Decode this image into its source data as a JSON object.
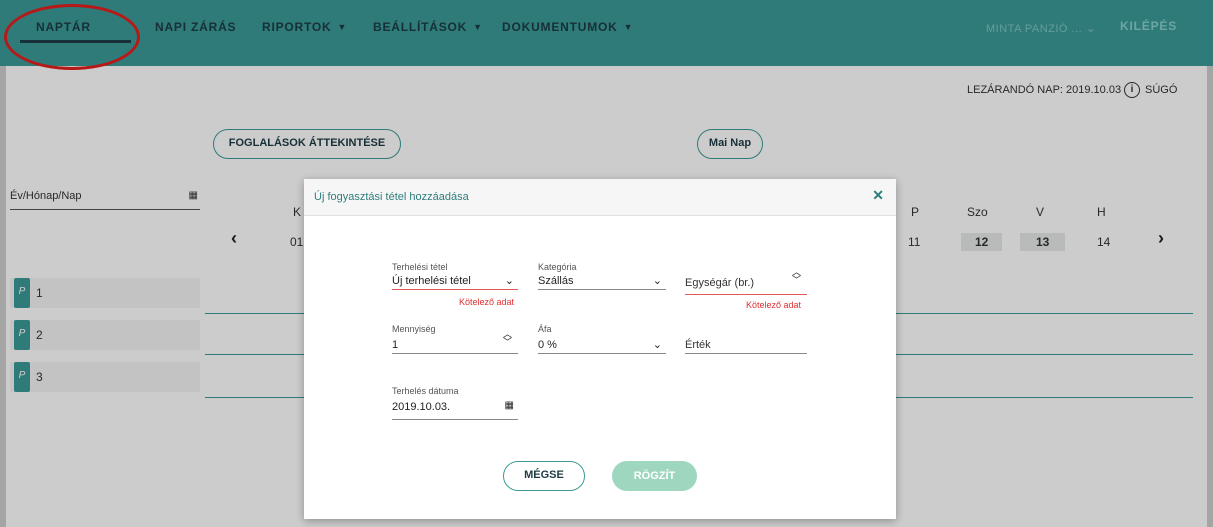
{
  "nav": {
    "items": [
      {
        "label": "NAPTÁR"
      },
      {
        "label": "NAPI ZÁRÁS"
      },
      {
        "label": "RIPORTOK"
      },
      {
        "label": "BEÁLLÍTÁSOK"
      },
      {
        "label": "DOKUMENTUMOK"
      }
    ],
    "property": "MINTA PANZIÓ ...",
    "exit": "KILÉPÉS",
    "brand_color": "#3b9a98"
  },
  "header": {
    "closing_day": "LEZÁRANDÓ NAP: 2019.10.03",
    "help": "SÚGÓ"
  },
  "calendar": {
    "overview_button": "FOGLALÁSOK ÁTTEKINTÉSE",
    "today_button": "Mai Nap",
    "date_label": "Év/Hónap/Nap",
    "hidden_head": "K",
    "hidden_num": "01",
    "days": [
      {
        "head": "P",
        "num": "11"
      },
      {
        "head": "Szo",
        "num": "12"
      },
      {
        "head": "V",
        "num": "13"
      },
      {
        "head": "H",
        "num": "14"
      }
    ],
    "rooms": [
      "1",
      "2",
      "3"
    ]
  },
  "modal": {
    "title": "Új fogyasztási tétel hozzáadása",
    "charge_item": {
      "label": "Terhelési tétel",
      "value": "Új terhelési tétel",
      "error": "Kötelező adat"
    },
    "category": {
      "label": "Kategória",
      "value": "Szállás"
    },
    "unit_price": {
      "placeholder": "Egységár (br.)",
      "error": "Kötelező adat"
    },
    "quantity": {
      "label": "Mennyiség",
      "value": "1"
    },
    "vat": {
      "label": "Áfa",
      "value": "0 %"
    },
    "amount": {
      "placeholder": "Érték"
    },
    "charge_date": {
      "label": "Terhelés dátuma",
      "value": "2019.10.03."
    },
    "cancel": "MÉGSE",
    "save": "RÖGZÍT"
  }
}
